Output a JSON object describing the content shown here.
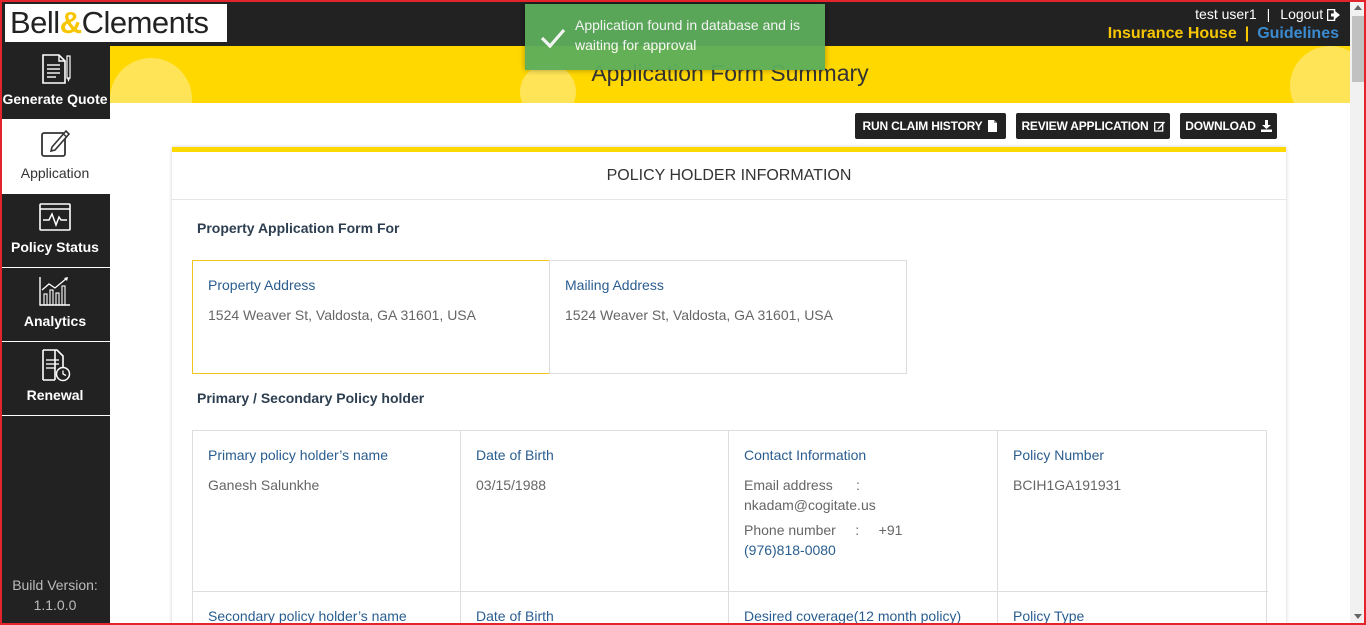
{
  "brand": {
    "name_left": "Bell",
    "name_amp": "&",
    "name_right": "Clements"
  },
  "header": {
    "user": "test user1",
    "separator": "|",
    "logout_label": "Logout",
    "insurance_house": "Insurance House",
    "links_separator": "|",
    "guidelines": "Guidelines"
  },
  "sidebar": {
    "items": [
      {
        "label": "Generate Quote",
        "icon": "quote-document-icon"
      },
      {
        "label": "Application",
        "icon": "edit-pencil-icon"
      },
      {
        "label": "Policy Status",
        "icon": "status-monitor-icon"
      },
      {
        "label": "Analytics",
        "icon": "analytics-chart-icon"
      },
      {
        "label": "Renewal",
        "icon": "renewal-clock-icon"
      }
    ],
    "build_label": "Build Version:",
    "build_version": "1.1.0.0"
  },
  "toast": {
    "message": "Application found in database and is waiting for approval"
  },
  "page": {
    "title": "Application Form Summary"
  },
  "actions": {
    "run_claim_history": "RUN CLAIM HISTORY",
    "review_application": "REVIEW APPLICATION",
    "download": "DOWNLOAD"
  },
  "card": {
    "heading": "POLICY HOLDER INFORMATION",
    "property_section_title": "Property Application Form For",
    "property_address_label": "Property Address",
    "property_address": "1524 Weaver St, Valdosta, GA 31601, USA",
    "mailing_address_label": "Mailing Address",
    "mailing_address": "1524 Weaver St, Valdosta, GA 31601, USA",
    "holders_section_title": "Primary / Secondary Policy holder",
    "primary_name_label": "Primary policy holder’s name",
    "primary_name": "Ganesh Salunkhe",
    "dob_label": "Date of Birth",
    "dob": "03/15/1988",
    "contact_label": "Contact Information",
    "email_label": "Email address",
    "email_sep": ":",
    "email": "nkadam@cogitate.us",
    "phone_label": "Phone number",
    "phone_sep": ":",
    "phone_prefix": "+91",
    "phone": "(976)818-0080",
    "policy_number_label": "Policy Number",
    "policy_number": "BCIH1GA191931",
    "secondary_name_label": "Secondary policy holder’s name",
    "secondary_dob_label": "Date of Birth",
    "desired_coverage_label": "Desired coverage(12 month policy)",
    "policy_type_label": "Policy Type"
  },
  "colors": {
    "brand_yellow": "#ffd800",
    "dark": "#222222",
    "link_blue": "#3a8bd0",
    "toast_green": "#5cae5c",
    "label_blue": "#2a5d8f"
  }
}
